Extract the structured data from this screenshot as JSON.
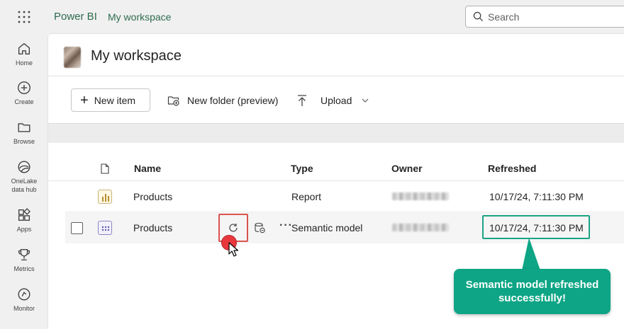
{
  "app": {
    "brand": "Power BI",
    "breadcrumb": "My workspace"
  },
  "search": {
    "placeholder": "Search"
  },
  "rail": {
    "items": [
      {
        "label": "Home",
        "icon": "home-icon"
      },
      {
        "label": "Create",
        "icon": "create-icon"
      },
      {
        "label": "Browse",
        "icon": "folder-icon"
      },
      {
        "label": "OneLake data hub",
        "icon": "onelake-icon"
      },
      {
        "label": "Apps",
        "icon": "apps-icon"
      },
      {
        "label": "Metrics",
        "icon": "trophy-icon"
      },
      {
        "label": "Monitor",
        "icon": "monitor-icon"
      }
    ]
  },
  "workspace": {
    "title": "My workspace"
  },
  "toolbar": {
    "new_item": "New item",
    "new_folder": "New folder (preview)",
    "upload": "Upload"
  },
  "table": {
    "headers": {
      "name": "Name",
      "type": "Type",
      "owner": "Owner",
      "refreshed": "Refreshed"
    },
    "rows": [
      {
        "name": "Products",
        "type": "Report",
        "refreshed": "10/17/24, 7:11:30 PM"
      },
      {
        "name": "Products",
        "type": "Semantic model",
        "refreshed": "10/17/24, 7:11:30 PM"
      }
    ]
  },
  "callout": {
    "text": "Semantic model refreshed successfully!"
  },
  "colors": {
    "accent_green": "#0da585",
    "highlight_red": "#d9534f",
    "brand_green": "#2e6b4f"
  }
}
